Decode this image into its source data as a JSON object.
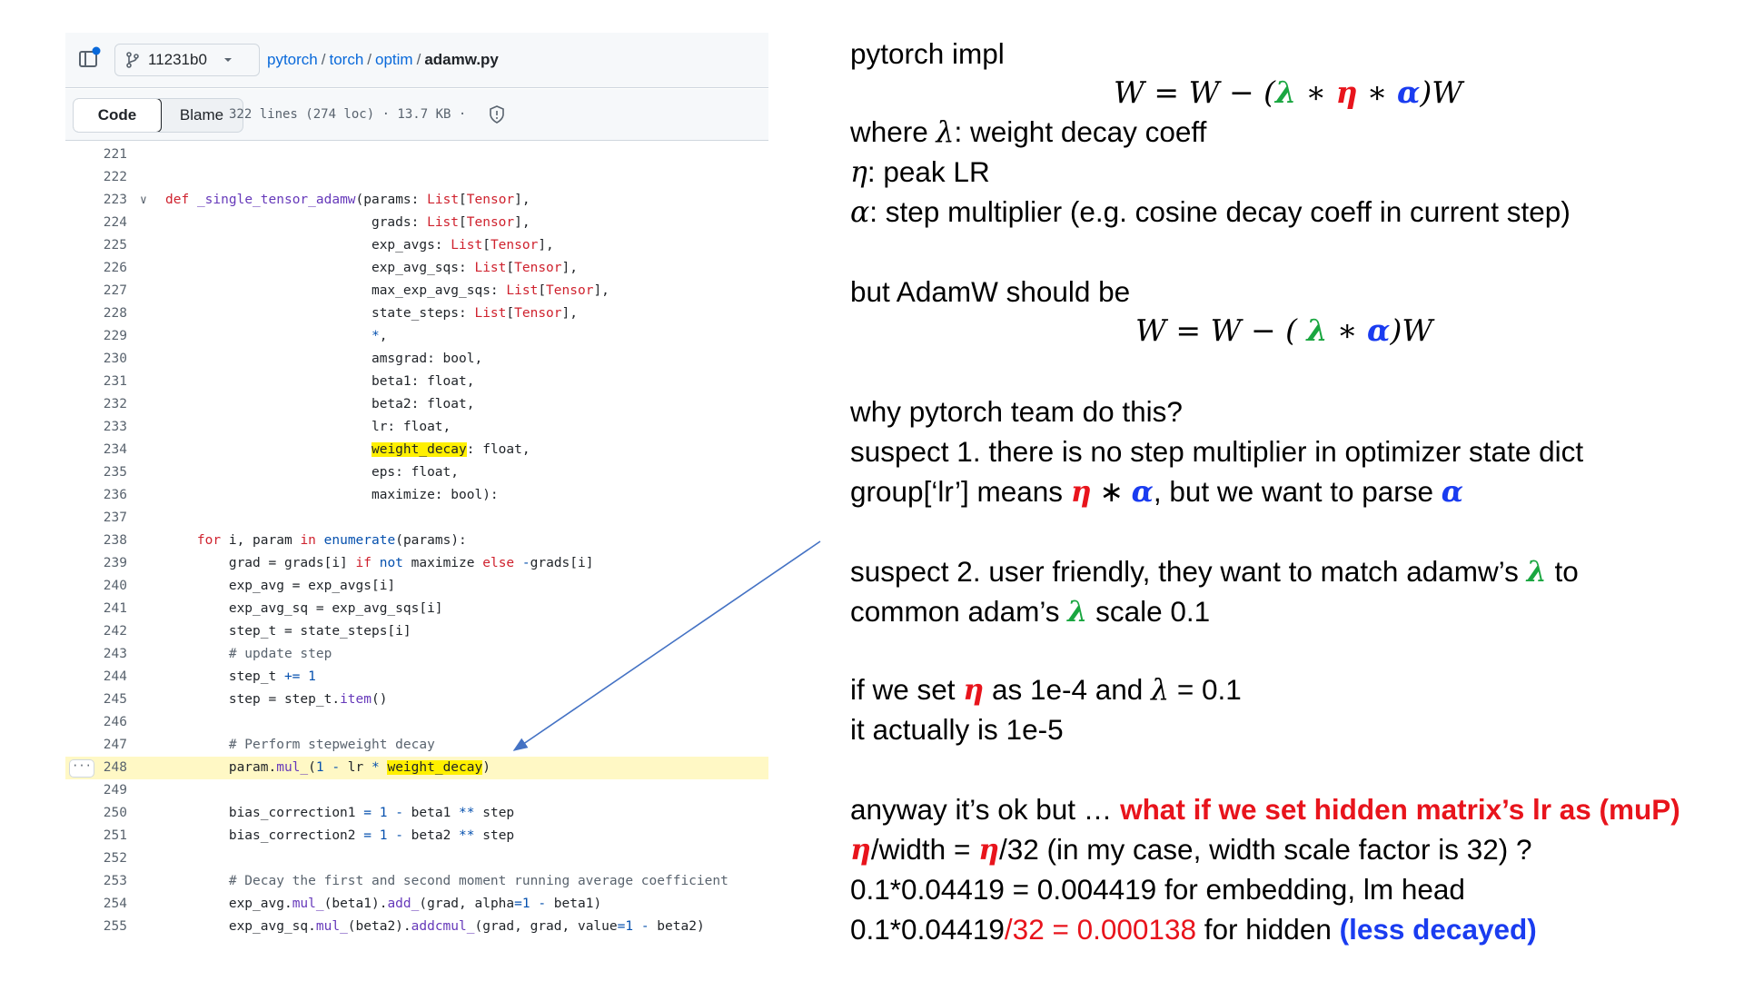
{
  "header": {
    "commit": "11231b0",
    "breadcrumb": [
      "pytorch",
      "torch",
      "optim"
    ],
    "filename": "adamw.py"
  },
  "tabs": {
    "code": "Code",
    "blame": "Blame"
  },
  "file_meta": "322 lines (274 loc) · 13.7 KB ·",
  "code_lines": [
    {
      "n": "221"
    },
    {
      "n": "222"
    },
    {
      "n": "223"
    },
    {
      "n": "224"
    },
    {
      "n": "225"
    },
    {
      "n": "226"
    },
    {
      "n": "227"
    },
    {
      "n": "228"
    },
    {
      "n": "229"
    },
    {
      "n": "230"
    },
    {
      "n": "231"
    },
    {
      "n": "232"
    },
    {
      "n": "233"
    },
    {
      "n": "234"
    },
    {
      "n": "235"
    },
    {
      "n": "236"
    },
    {
      "n": "237"
    },
    {
      "n": "238"
    },
    {
      "n": "239"
    },
    {
      "n": "240"
    },
    {
      "n": "241"
    },
    {
      "n": "242"
    },
    {
      "n": "243"
    },
    {
      "n": "244"
    },
    {
      "n": "245"
    },
    {
      "n": "246"
    },
    {
      "n": "247"
    },
    {
      "n": "248"
    },
    {
      "n": "249"
    },
    {
      "n": "250"
    },
    {
      "n": "251"
    },
    {
      "n": "252"
    },
    {
      "n": "253"
    },
    {
      "n": "254"
    },
    {
      "n": "255"
    }
  ],
  "notes": {
    "n1": "pytorch impl",
    "n2_pre": "where ",
    "n2_sym": "λ",
    "n2_post": ": weight decay coeff",
    "n3_sym": "η",
    "n3_post": ": peak LR",
    "n4_sym": "α",
    "n4_post": ": step multiplier (e.g. cosine decay coeff in current step)",
    "n5": "but AdamW should be",
    "n6": "why pytorch team do this?",
    "n7": "suspect 1. there is no step multiplier in optimizer state dict",
    "n8_pre": "group[‘lr’] means ",
    "n8_eta": "η",
    "n8_star": " ∗ ",
    "n8_alpha": "α",
    "n8_mid": ", but we want to parse ",
    "n8_alpha2": "α",
    "n9_pre": "suspect 2. user friendly, they want to match adamw’s ",
    "n9_lam": "λ",
    "n9_post": " to",
    "n10_pre": "common adam’s ",
    "n10_lam": "λ",
    "n10_post": " scale 0.1",
    "n11_pre": "if we set ",
    "n11_eta": "η",
    "n11_mid": " as 1e-4 and ",
    "n11_lam": "λ",
    "n11_post": " = 0.1",
    "n12": "it actually is 1e-5",
    "n13_pre": "anyway it’s ok but … ",
    "n13_red": "what if we set hidden matrix’s lr as (muP)",
    "n14_eta": "η",
    "n14_a": "/width = ",
    "n14_eta2": "η",
    "n14_post": "/32 (in my case, width scale factor is 32) ?",
    "n15": "0.1*0.04419 = 0.004419 for embedding, lm head",
    "n16_pre": "0.1*0.04419",
    "n16_red": "/32 = 0.000138",
    "n16_mid": " for hidden ",
    "n16_blue": "(less decayed)"
  },
  "equations": {
    "eq1": {
      "W": "W",
      "eq": " = ",
      "W2": "W",
      "minus": " − (",
      "lam": "λ",
      "s1": " ∗ ",
      "eta": "η",
      "s2": " ∗ ",
      "alpha": "α",
      "end": ")W"
    },
    "eq2": {
      "W": "W",
      "eq": " = ",
      "W2": "W",
      "minus": " − ( ",
      "lam": "λ",
      "s1": " ∗ ",
      "alpha": "α",
      "end": ")W"
    }
  },
  "colors": {
    "lambda": "#1aa640",
    "eta": "#e8141c",
    "alpha": "#1a3cf0",
    "highlight": "#fff000",
    "arrow": "#4472c4"
  },
  "icons": [
    "file-tree-icon",
    "git-branch-icon",
    "chevron-down-icon",
    "shield-icon",
    "kebab-icon"
  ]
}
